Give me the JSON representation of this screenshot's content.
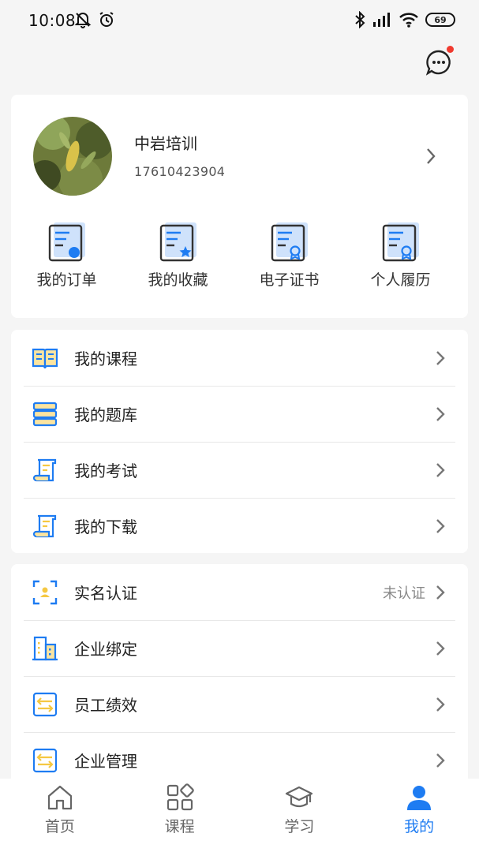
{
  "status_bar": {
    "time": "10:08",
    "battery": "69"
  },
  "profile": {
    "name": "中岩培训",
    "phone": "17610423904"
  },
  "quick_actions": [
    {
      "label": "我的订单",
      "icon": "order-doc-icon"
    },
    {
      "label": "我的收藏",
      "icon": "favorite-doc-icon"
    },
    {
      "label": "电子证书",
      "icon": "certificate-icon"
    },
    {
      "label": "个人履历",
      "icon": "resume-icon"
    }
  ],
  "menu_group_1": [
    {
      "label": "我的课程",
      "icon": "book-icon"
    },
    {
      "label": "我的题库",
      "icon": "question-bank-icon"
    },
    {
      "label": "我的考试",
      "icon": "exam-scroll-icon"
    },
    {
      "label": "我的下载",
      "icon": "download-scroll-icon"
    }
  ],
  "menu_group_2": [
    {
      "label": "实名认证",
      "icon": "id-verify-icon",
      "extra": "未认证"
    },
    {
      "label": "企业绑定",
      "icon": "building-icon"
    },
    {
      "label": "员工绩效",
      "icon": "performance-icon"
    },
    {
      "label": "企业管理",
      "icon": "management-icon"
    }
  ],
  "tabbar": [
    {
      "label": "首页",
      "icon": "home-icon",
      "active": false
    },
    {
      "label": "课程",
      "icon": "course-grid-icon",
      "active": false
    },
    {
      "label": "学习",
      "icon": "graduation-cap-icon",
      "active": false
    },
    {
      "label": "我的",
      "icon": "user-icon",
      "active": true
    }
  ],
  "colors": {
    "accent": "#1e7cf2",
    "accent_light": "#cfe2fb",
    "icon_yellow": "#f5c842",
    "notification": "#f03a2f"
  }
}
